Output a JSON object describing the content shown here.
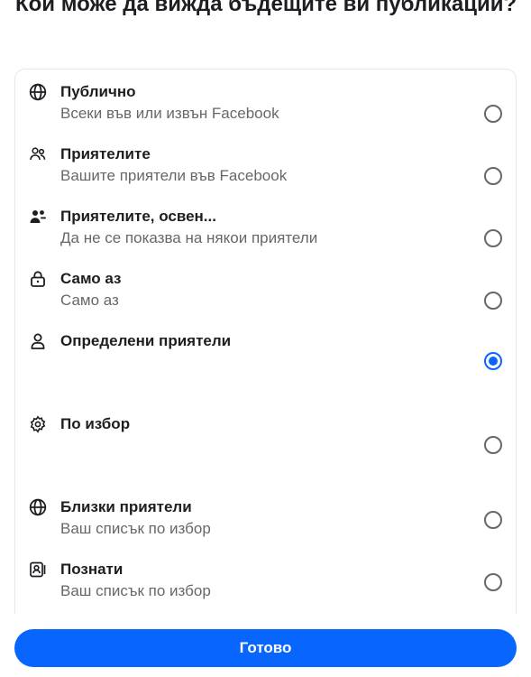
{
  "header": {
    "title": "Кой може да вижда бъдещите ви публикации?"
  },
  "accent_color": "#0866ff",
  "options": [
    {
      "icon": "globe-icon",
      "title": "Публично",
      "subtitle": "Всеки във или извън Facebook",
      "selected": false
    },
    {
      "icon": "friends-icon",
      "title": "Приятелите",
      "subtitle": "Вашите приятели във Facebook",
      "selected": false
    },
    {
      "icon": "friends-except-icon",
      "title": "Приятелите, освен...",
      "subtitle": "Да не се показва на някои приятели",
      "selected": false
    },
    {
      "icon": "lock-icon",
      "title": "Само аз",
      "subtitle": "Само аз",
      "selected": false
    },
    {
      "icon": "person-icon",
      "title": "Определени приятели",
      "subtitle": "",
      "selected": true
    },
    {
      "icon": "gear-icon",
      "title": "По избор",
      "subtitle": "",
      "selected": false
    },
    {
      "icon": "globe-icon",
      "title": "Близки приятели",
      "subtitle": "Ваш списък по избор",
      "selected": false
    },
    {
      "icon": "contact-card-icon",
      "title": "Познати",
      "subtitle": "Ваш списък по избор",
      "selected": false
    }
  ],
  "footer": {
    "done_label": "Готово"
  }
}
